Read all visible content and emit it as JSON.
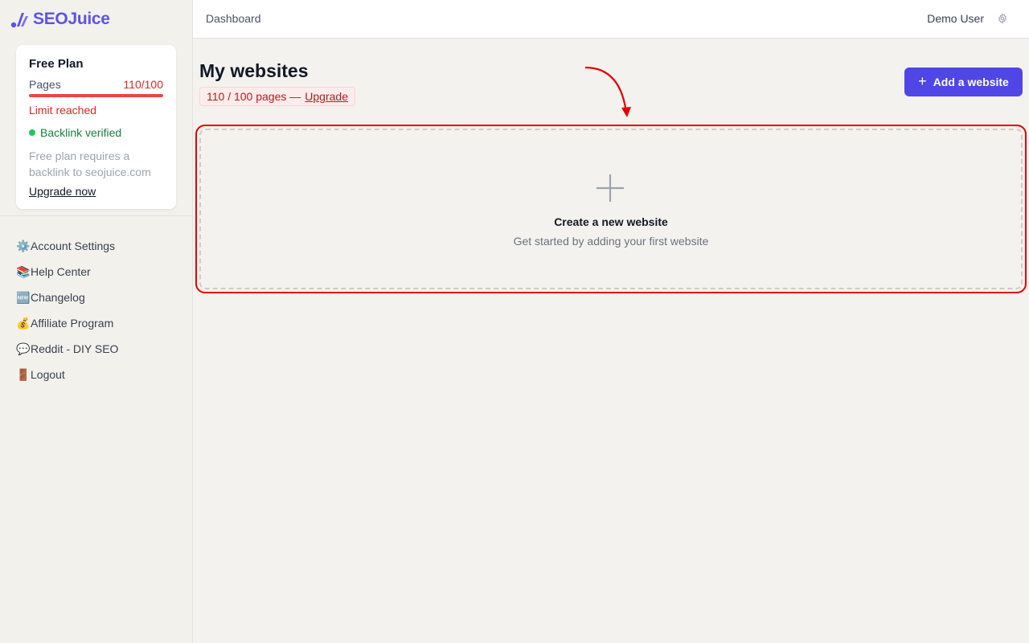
{
  "brand": {
    "name": "SEOJuice",
    "color": "#5b54e8"
  },
  "plan": {
    "title": "Free Plan",
    "pages_label": "Pages",
    "pages_count": "110/100",
    "usage_fraction": 1.0,
    "limit_text": "Limit reached",
    "backlink_text": "Backlink verified",
    "note": "Free plan requires a backlink to seojuice.com",
    "upgrade_link": "Upgrade now"
  },
  "sidebar": {
    "items": [
      {
        "emoji": "⚙️",
        "label": "Account Settings"
      },
      {
        "emoji": "📚",
        "label": "Help Center"
      },
      {
        "emoji": "🆕",
        "label": "Changelog"
      },
      {
        "emoji": "💰",
        "label": "Affiliate Program"
      },
      {
        "emoji": "💬",
        "label": "Reddit - DIY SEO"
      },
      {
        "emoji": "🚪",
        "label": "Logout"
      }
    ]
  },
  "header": {
    "breadcrumb": "Dashboard",
    "user_name": "Demo User",
    "settings_icon": "gear-icon"
  },
  "main": {
    "title": "My websites",
    "quota_text": "110 / 100 pages —",
    "quota_link": "Upgrade",
    "add_button": "Add a website",
    "empty_state": {
      "title": "Create a new website",
      "subtitle": "Get started by adding your first website"
    }
  },
  "colors": {
    "accent": "#4f46e5",
    "danger": "#dc2626",
    "success": "#22c55e",
    "highlight": "#e60000"
  }
}
